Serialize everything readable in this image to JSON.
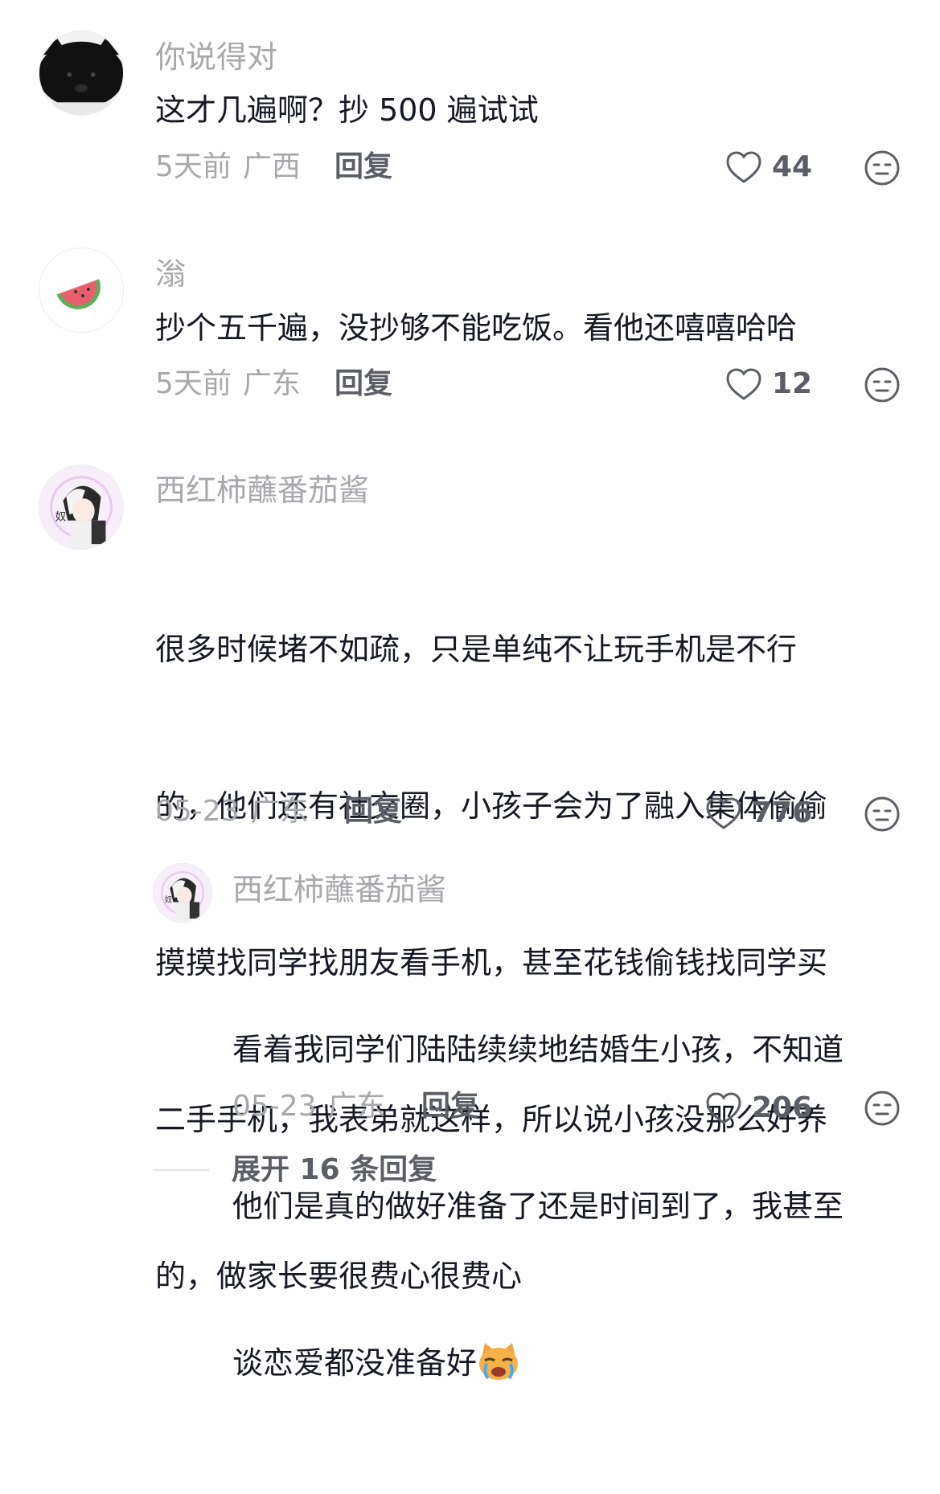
{
  "comments": [
    {
      "username": "你说得对",
      "text": "这才几遍啊？抄 500 遍试试",
      "time": "5天前",
      "location": "广西",
      "reply_label": "回复",
      "likes": "44",
      "avatar_icon": "black-cat-avatar"
    },
    {
      "username": "滃",
      "text": "抄个五千遍，没抄够不能吃饭。看他还嘻嘻哈哈",
      "time": "5天前",
      "location": "广东",
      "reply_label": "回复",
      "likes": "12",
      "avatar_icon": "watermelon-avatar"
    },
    {
      "username": "西红柿蘸番茄酱",
      "lines": [
        "很多时候堵不如疏，只是单纯不让玩手机是不行",
        "的，他们还有社交圈，小孩子会为了融入集体偷偷",
        "摸摸找同学找朋友看手机，甚至花钱偷钱找同学买",
        "二手手机，我表弟就这样，所以说小孩没那么好养",
        "的，做家长要很费心很费心"
      ],
      "time": "05-23",
      "location": "广东",
      "reply_label": "回复",
      "likes": "776",
      "avatar_icon": "anime-character-avatar"
    }
  ],
  "reply": {
    "username": "西红柿蘸番茄酱",
    "lines": [
      "看着我同学们陆陆续续地结婚生小孩，不知道",
      "他们是真的做好准备了还是时间到了，我甚至",
      "谈恋爱都没准备好"
    ],
    "emoji": "crying-cat-emoji",
    "time": "05-23",
    "location": "广东",
    "reply_label": "回复",
    "likes": "206",
    "avatar_icon": "anime-character-avatar"
  },
  "expand_replies": "展开 16 条回复",
  "colors": {
    "secondary_text": "#a7a8ad",
    "primary_text": "#161823",
    "action_text": "#5c5e66"
  }
}
